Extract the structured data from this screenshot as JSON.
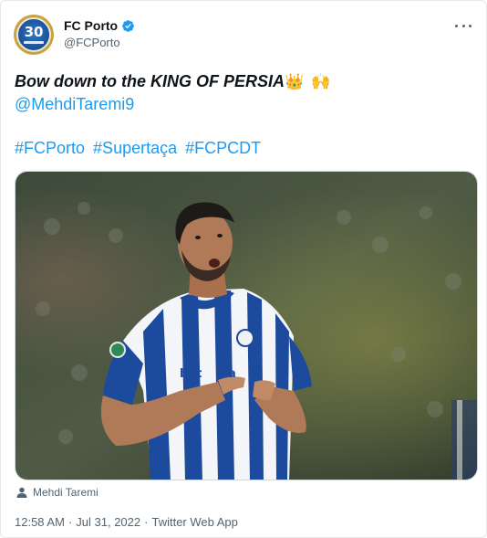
{
  "tweet": {
    "author": {
      "display_name": "FC Porto",
      "handle": "@FCPorto",
      "avatar_label": "30",
      "verified": true
    },
    "text": {
      "headline": "Bow down to the KING OF PERSIA",
      "emoji_crown": "👑",
      "emoji_hands": "🙌",
      "mention": "@MehdiTaremi9",
      "hashtags": [
        "#FCPorto",
        "#Supertaça",
        "#FCPCDT"
      ]
    },
    "media": {
      "tagged_person": "Mehdi Taremi"
    },
    "meta": {
      "time": "12:58 AM",
      "date": "Jul 31, 2022",
      "source": "Twitter Web App",
      "separator": "·"
    }
  },
  "icons": {
    "verified": "verified-badge-icon",
    "more": "more-options-icon",
    "person": "person-icon"
  },
  "colors": {
    "link": "#1d9bf0",
    "secondary_text": "#536471",
    "primary_text": "#0f1419",
    "jersey_blue": "#1c4a9c"
  }
}
